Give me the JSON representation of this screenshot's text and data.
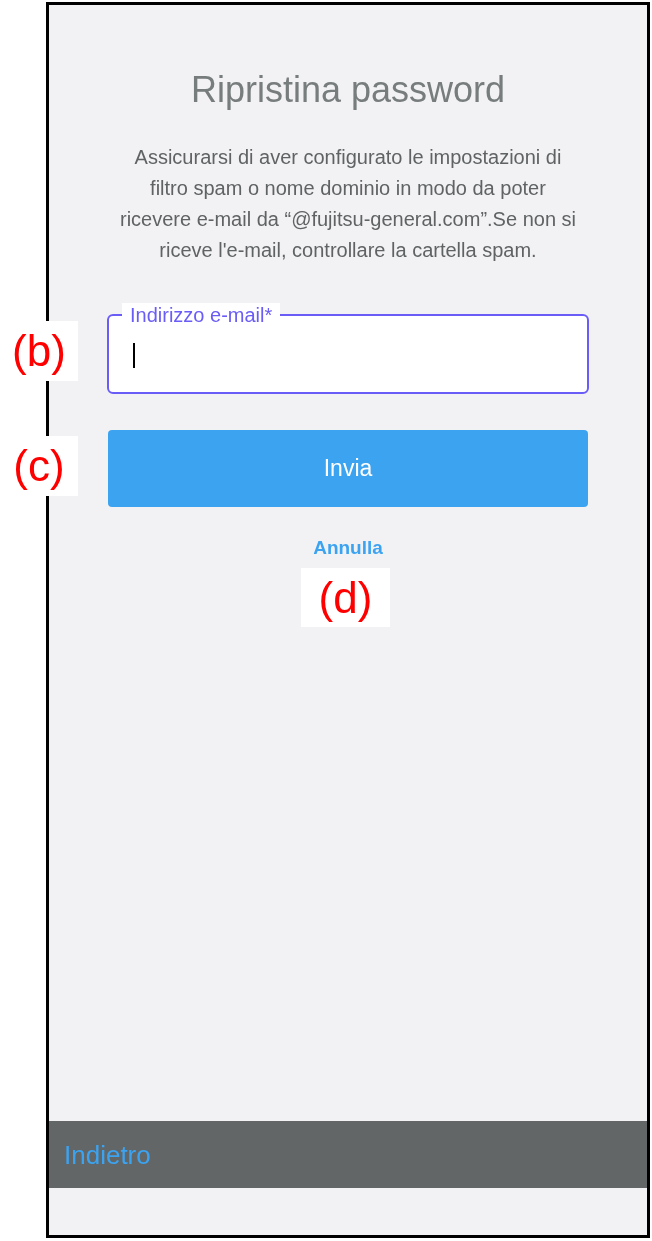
{
  "screen": {
    "title": "Ripristina password",
    "description_lines": [
      "Assicurarsi di aver configurato le impostazioni di",
      "filtro spam o nome dominio in modo da poter",
      "ricevere e-mail da “@fujitsu-general.com”.Se non si",
      "riceve l'e-mail, controllare la cartella spam."
    ],
    "email_field": {
      "label": "Indirizzo e-mail*",
      "focused": true,
      "callout": "(b)"
    },
    "submit_button": {
      "label": "Invia",
      "callout": "(c)"
    },
    "cancel_link": {
      "label": "Annulla",
      "callout": "(d)"
    }
  },
  "bottom_bar": {
    "back_button": {
      "label": "Indietro"
    }
  }
}
